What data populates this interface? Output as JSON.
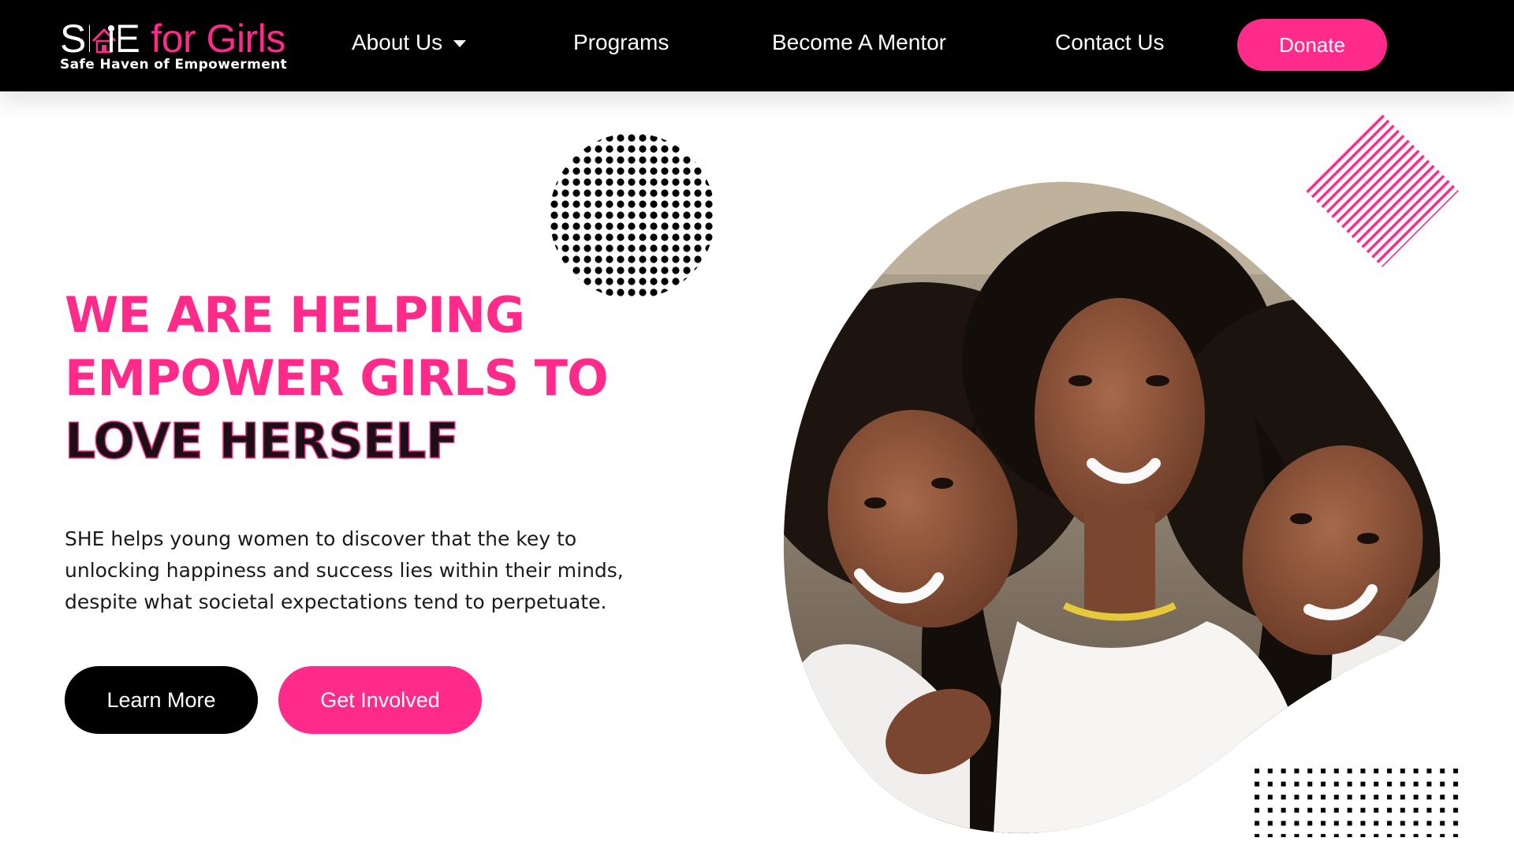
{
  "brand": {
    "logo_she": "SHE",
    "logo_for_girls": "for Girls",
    "tagline": "Safe Haven of Empowerment"
  },
  "nav": {
    "items": [
      {
        "label": "About Us",
        "has_dropdown": true
      },
      {
        "label": "Programs"
      },
      {
        "label": "Become A Mentor"
      },
      {
        "label": "Contact Us"
      }
    ],
    "donate_label": "Donate"
  },
  "hero": {
    "headline": [
      "WE ARE HELPING",
      "EMPOWER GIRLS TO",
      "LOVE HERSELF"
    ],
    "description": "SHE helps young women to discover that the key to unlocking happiness and success lies within their minds, despite what societal expectations tend to perpetuate.",
    "buttons": {
      "learn_more": "Learn More",
      "get_involved": "Get Involved"
    }
  },
  "colors": {
    "brand_pink": "#ff2a8a",
    "nav_background": "#000000",
    "text_dark": "#1a1a1a"
  },
  "icons": {
    "nav_dropdown": "caret-down-icon",
    "logo_mark": "house-icon"
  }
}
